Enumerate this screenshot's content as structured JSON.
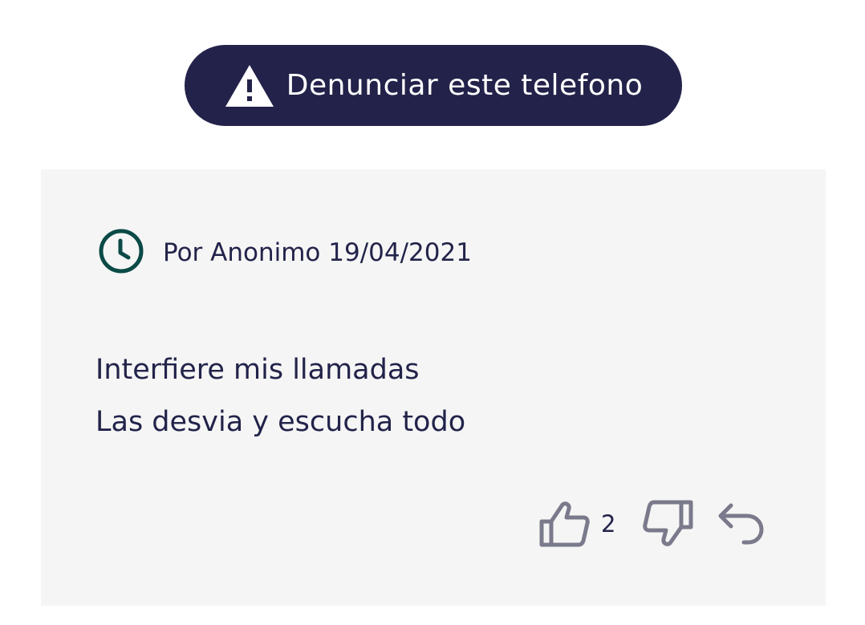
{
  "report_button": {
    "label": "Denunciar este telefono",
    "icon": "warning-triangle-icon",
    "background_color": "#23224a",
    "text_color": "#ffffff"
  },
  "comment": {
    "author_line": "Por Anonimo 19/04/2021",
    "meta_icon": "clock-icon",
    "meta_icon_color": "#0b4a46",
    "lines": [
      "Interfiere mis llamadas",
      "Las desvia y escucha todo"
    ],
    "actions": {
      "like_icon": "thumbs-up-icon",
      "like_count": "2",
      "dislike_icon": "thumbs-down-icon",
      "reply_icon": "reply-icon",
      "icon_color": "#7a7a8c"
    },
    "background_color": "#f5f5f5"
  }
}
